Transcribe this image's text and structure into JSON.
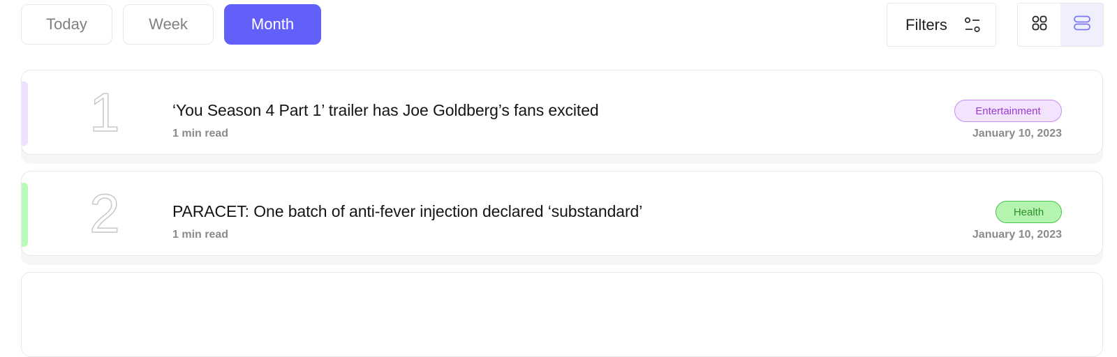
{
  "toolbar": {
    "period_buttons": [
      {
        "label": "Today",
        "active": false
      },
      {
        "label": "Week",
        "active": false
      },
      {
        "label": "Month",
        "active": true
      }
    ],
    "filters_label": "Filters",
    "filters_icon": "sliders-icon",
    "view_modes": [
      {
        "icon": "grid-view-icon",
        "active": false
      },
      {
        "icon": "list-view-icon",
        "active": true
      }
    ]
  },
  "articles": [
    {
      "rank": "1",
      "title": "‘You Season 4 Part 1’ trailer has Joe Goldberg’s fans excited",
      "read_time": "1 min read",
      "category": "Entertainment",
      "date": "January 10, 2023",
      "accent_color": "#f0e0ff",
      "badge_bg": "#f3e3ff",
      "badge_border": "#c98cf2",
      "badge_text": "#9b3ad0"
    },
    {
      "rank": "2",
      "title": "PARACET: One batch of anti-fever injection declared ‘substandard’",
      "read_time": "1 min read",
      "category": "Health",
      "date": "January 10, 2023",
      "accent_color": "#b9fcb9",
      "badge_bg": "#b5f5b0",
      "badge_border": "#48c448",
      "badge_text": "#2b8f2b"
    }
  ],
  "colors": {
    "primary": "#6260f9",
    "active_view_bg": "#efeffe"
  }
}
